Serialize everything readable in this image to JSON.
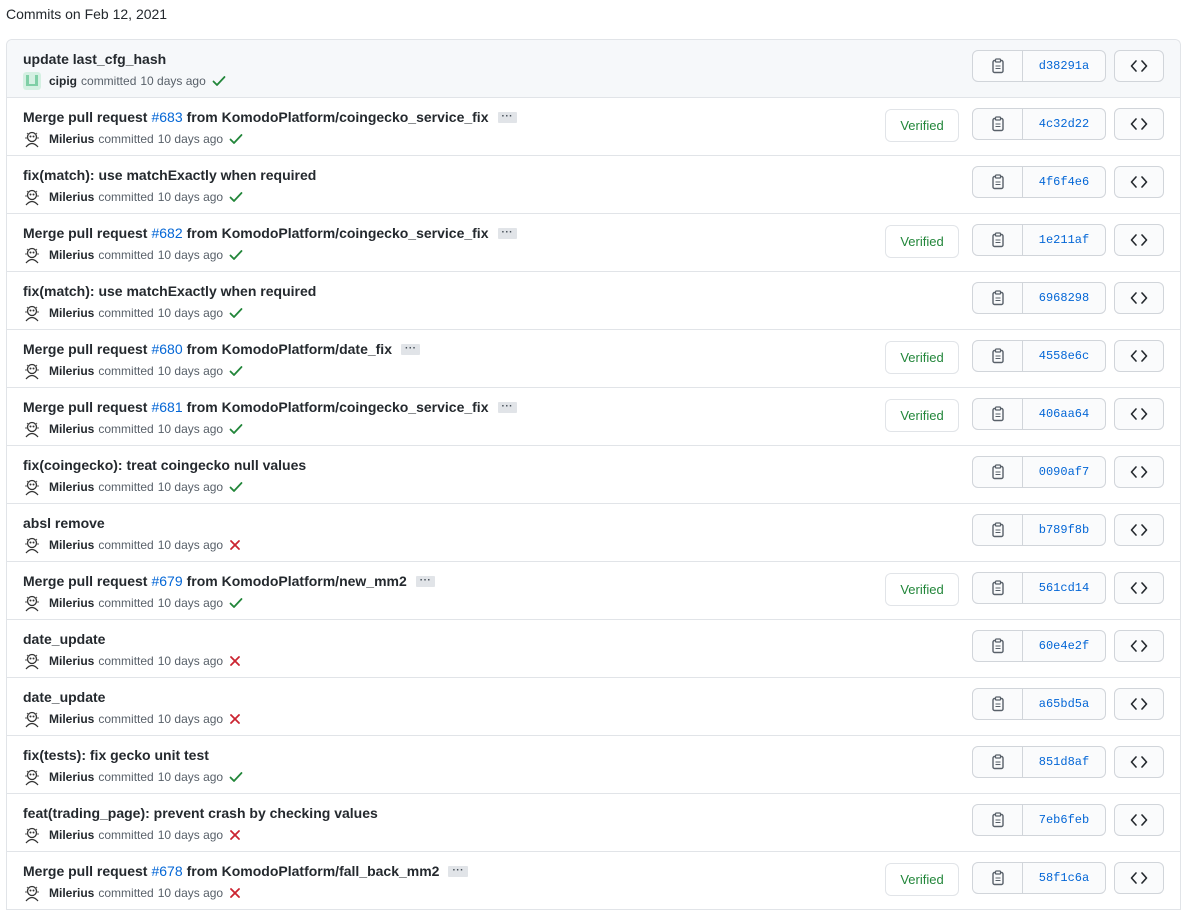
{
  "heading": "Commits on Feb 12, 2021",
  "labels": {
    "committed": "committed",
    "verified": "Verified",
    "ellipsis": "···"
  },
  "colors": {
    "success": "#22863a",
    "failure": "#cb2431",
    "link": "#0366d6"
  },
  "commits": [
    {
      "title": "update last_cfg_hash",
      "author": "cipig",
      "time": "10 days ago",
      "status": "success",
      "verified": false,
      "sha": "d38291a"
    },
    {
      "title_prefix": "Merge pull request",
      "pr": "#683",
      "title_suffix": "from KomodoPlatform/coingecko_service_fix",
      "author": "Milerius",
      "time": "10 days ago",
      "status": "success",
      "verified": true,
      "sha": "4c32d22"
    },
    {
      "title": "fix(match): use matchExactly when required",
      "author": "Milerius",
      "time": "10 days ago",
      "status": "success",
      "verified": false,
      "sha": "4f6f4e6"
    },
    {
      "title_prefix": "Merge pull request",
      "pr": "#682",
      "title_suffix": "from KomodoPlatform/coingecko_service_fix",
      "author": "Milerius",
      "time": "10 days ago",
      "status": "success",
      "verified": true,
      "sha": "1e211af"
    },
    {
      "title": "fix(match): use matchExactly when required",
      "author": "Milerius",
      "time": "10 days ago",
      "status": "success",
      "verified": false,
      "sha": "6968298"
    },
    {
      "title_prefix": "Merge pull request",
      "pr": "#680",
      "title_suffix": "from KomodoPlatform/date_fix",
      "author": "Milerius",
      "time": "10 days ago",
      "status": "success",
      "verified": true,
      "sha": "4558e6c"
    },
    {
      "title_prefix": "Merge pull request",
      "pr": "#681",
      "title_suffix": "from KomodoPlatform/coingecko_service_fix",
      "author": "Milerius",
      "time": "10 days ago",
      "status": "success",
      "verified": true,
      "sha": "406aa64"
    },
    {
      "title": "fix(coingecko): treat coingecko null values",
      "author": "Milerius",
      "time": "10 days ago",
      "status": "success",
      "verified": false,
      "sha": "0090af7"
    },
    {
      "title": "absl remove",
      "author": "Milerius",
      "time": "10 days ago",
      "status": "failure",
      "verified": false,
      "sha": "b789f8b"
    },
    {
      "title_prefix": "Merge pull request",
      "pr": "#679",
      "title_suffix": "from KomodoPlatform/new_mm2",
      "author": "Milerius",
      "time": "10 days ago",
      "status": "success",
      "verified": true,
      "sha": "561cd14"
    },
    {
      "title": "date_update",
      "author": "Milerius",
      "time": "10 days ago",
      "status": "failure",
      "verified": false,
      "sha": "60e4e2f"
    },
    {
      "title": "date_update",
      "author": "Milerius",
      "time": "10 days ago",
      "status": "failure",
      "verified": false,
      "sha": "a65bd5a"
    },
    {
      "title": "fix(tests): fix gecko unit test",
      "author": "Milerius",
      "time": "10 days ago",
      "status": "success",
      "verified": false,
      "sha": "851d8af"
    },
    {
      "title": "feat(trading_page): prevent crash by checking values",
      "author": "Milerius",
      "time": "10 days ago",
      "status": "failure",
      "verified": false,
      "sha": "7eb6feb"
    },
    {
      "title_prefix": "Merge pull request",
      "pr": "#678",
      "title_suffix": "from KomodoPlatform/fall_back_mm2",
      "author": "Milerius",
      "time": "10 days ago",
      "status": "failure",
      "verified": true,
      "sha": "58f1c6a"
    }
  ]
}
